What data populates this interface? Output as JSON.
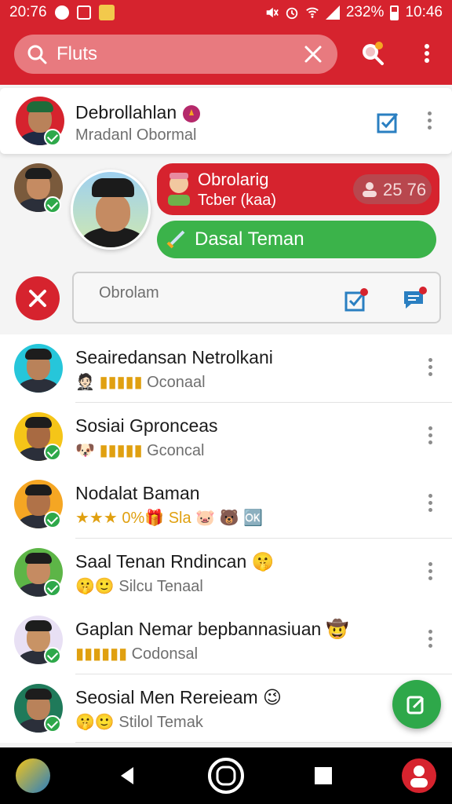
{
  "status_bar": {
    "time_left": "20:76",
    "battery": "232%",
    "clock": "10:46"
  },
  "search": {
    "value": "Fluts",
    "placeholder": ""
  },
  "colors": {
    "brand_red": "#d6232e",
    "accent_green": "#2ea84a",
    "dark_red": "#b8474e"
  },
  "pinned_chat": {
    "name": "Debrollahlan",
    "subtitle": "Mradanl Obormal"
  },
  "expanded": {
    "bubble_title": "Obrolarig",
    "bubble_sub": "Tcber (kaa)",
    "pill_value": "25 76",
    "action_label": "Dasal Teman",
    "composer_placeholder": "Obrolam"
  },
  "chats": [
    {
      "name": "Seairedansan Netrolkani",
      "emojis": "🤵🏻 ▮▮▮▮▮",
      "subtitle": "Oconaal",
      "verified": false,
      "skin": "#b9825a",
      "bg": "#26c6da"
    },
    {
      "name": "Sosiai Gpronceas",
      "emojis": "🐶 ▮▮▮▮▮",
      "subtitle": "Gconcal",
      "verified": true,
      "skin": "#a86a42",
      "bg": "#f5c518"
    },
    {
      "name": "Nodalat Baman",
      "emojis": "★★★ 0%🎁 Sla 🐷 🐻 🆗",
      "subtitle": "",
      "verified": true,
      "skin": "#b07248",
      "bg": "#f5a623"
    },
    {
      "name": "Saal Tenan Rndincan 🤫",
      "emojis": "🤫🙂",
      "subtitle": "Silcu Tenaal",
      "verified": true,
      "skin": "#c58b62",
      "bg": "#5db547"
    },
    {
      "name": "Gaplan Nemar bepbannasiuan 🤠",
      "emojis": "▮▮▮▮▮▮",
      "subtitle": "Codonsal",
      "verified": true,
      "skin": "#c89365",
      "bg": "#e8e0f4"
    },
    {
      "name": "Seosial Men Rereieam 😉",
      "emojis": "🤫🙂",
      "subtitle": "Stilol Temak",
      "verified": true,
      "skin": "#b9825a",
      "bg": "#1f7a5a"
    }
  ]
}
